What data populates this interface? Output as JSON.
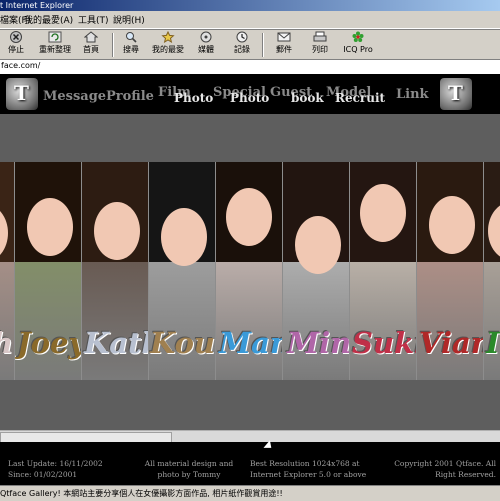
{
  "window": {
    "title": "t Internet Explorer"
  },
  "menubar": {
    "items": [
      {
        "label": "檔案(F)"
      },
      {
        "label": "我的最愛(A)"
      },
      {
        "label": "工具(T)"
      },
      {
        "label": "說明(H)"
      }
    ]
  },
  "toolbar": {
    "buttons": [
      {
        "label": "停止",
        "icon": "stop-icon"
      },
      {
        "label": "重新整理",
        "icon": "refresh-icon"
      },
      {
        "label": "首頁",
        "icon": "home-icon"
      },
      {
        "label": "搜尋",
        "icon": "search-icon"
      },
      {
        "label": "我的最愛",
        "icon": "favorites-icon"
      },
      {
        "label": "媒體",
        "icon": "media-icon"
      },
      {
        "label": "記錄",
        "icon": "history-icon"
      },
      {
        "label": "郵件",
        "icon": "mail-icon"
      },
      {
        "label": "列印",
        "icon": "print-icon"
      },
      {
        "label": "ICQ Pro",
        "icon": "icq-flower-icon"
      }
    ]
  },
  "address": {
    "url": "face.com/"
  },
  "site": {
    "logo_letter": "T",
    "nav": {
      "message": "Message",
      "profile": "Profile",
      "film": "Film",
      "film_sub": "Photo",
      "special": "Special",
      "special_sub": "Photo",
      "guest": "Guest",
      "guest_sub": "book",
      "model": "Model",
      "model_sub": "Recruit",
      "link": "Link"
    },
    "models": [
      {
        "name": "h",
        "hair": "#3a2416",
        "bg": "#c9a091",
        "name_color": "#d8c6c6"
      },
      {
        "name": "Joey",
        "hair": "#1f1209",
        "bg": "#8aa05a",
        "name_color": "#8a6a2a"
      },
      {
        "name": "Kathy",
        "hair": "#2d1c12",
        "bg": "#5a4032",
        "name_color": "#b8c0d0"
      },
      {
        "name": "Kouey",
        "hair": "#151515",
        "bg": "#bbbbbb",
        "name_color": "#a08050"
      },
      {
        "name": "Mandy",
        "hair": "#1a100a",
        "bg": "#f0d8d0",
        "name_color": "#3a9ad8"
      },
      {
        "name": "Mina",
        "hair": "#221510",
        "bg": "#d8d8d8",
        "name_color": "#b066a8"
      },
      {
        "name": "Suki",
        "hair": "#241611",
        "bg": "#eeddcc",
        "name_color": "#c03048"
      },
      {
        "name": "Vian",
        "hair": "#2a1a10",
        "bg": "#d8a090",
        "name_color": "#b02828"
      },
      {
        "name": "I",
        "hair": "#2a1c14",
        "bg": "#d0c0b0",
        "name_color": "#2a8a2a"
      }
    ],
    "footer": {
      "last_update": "Last Update: 16/11/2002 Since: 01/02/2001",
      "credits": "All material design and photo by Tommy",
      "resolution": "Best Resolution 1024x768 at Internet Explorer 5.0 or above",
      "copyright": "Copyright 2001 Qtface. All Right Reserved."
    }
  },
  "status": {
    "text": "Qtface Gallery! 本網站主要分享個人在女優攝影方面作品, 相片紙作觀賞用途!!"
  }
}
